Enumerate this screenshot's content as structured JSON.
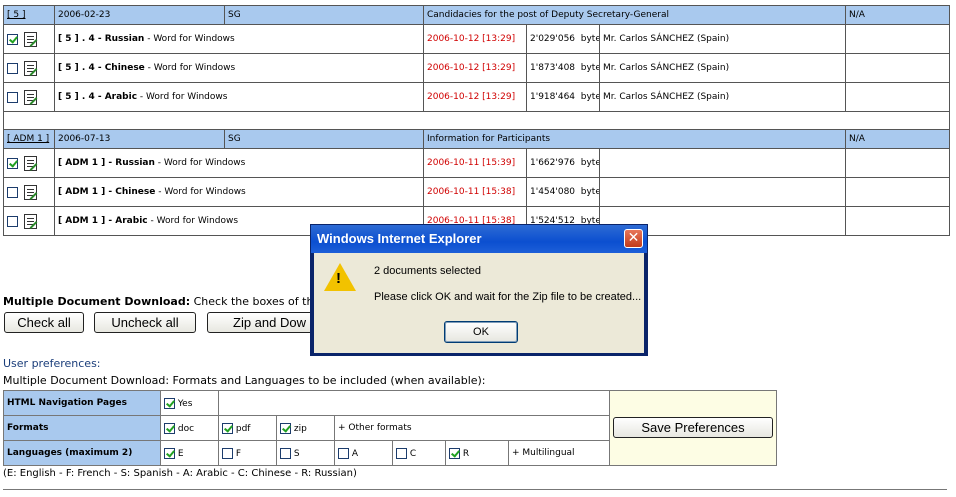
{
  "groups": [
    {
      "ref": "[ 5 ]",
      "date": "2006-02-23",
      "org": "SG",
      "title": "Candidacies for the post of Deputy Secretary-General",
      "status": "N/A",
      "rows": [
        {
          "checked": true,
          "name": "[ 5 ] . 4 - Russian",
          "format": "Word for Windows",
          "timestamp": "2006-10-12 [13:29]",
          "size": "2'029'056",
          "unit": "bytes",
          "author": "Mr. Carlos SÁNCHEZ (Spain)"
        },
        {
          "checked": false,
          "name": "[ 5 ] . 4 - Chinese",
          "format": "Word for Windows",
          "timestamp": "2006-10-12 [13:29]",
          "size": "1'873'408",
          "unit": "bytes",
          "author": "Mr. Carlos SÁNCHEZ (Spain)"
        },
        {
          "checked": false,
          "name": "[ 5 ] . 4 - Arabic",
          "format": "Word for Windows",
          "timestamp": "2006-10-12 [13:29]",
          "size": "1'918'464",
          "unit": "bytes",
          "author": "Mr. Carlos SÁNCHEZ (Spain)"
        }
      ]
    },
    {
      "ref": "[ ADM 1 ]",
      "date": "2006-07-13",
      "org": "SG",
      "title": "Information for Participants",
      "status": "N/A",
      "rows": [
        {
          "checked": true,
          "name": "[ ADM 1 ] - Russian",
          "format": "Word for Windows",
          "timestamp": "2006-10-11 [15:39]",
          "size": "1'662'976",
          "unit": "bytes",
          "author": ""
        },
        {
          "checked": false,
          "name": "[ ADM 1 ] - Chinese",
          "format": "Word for Windows",
          "timestamp": "2006-10-11 [15:38]",
          "size": "1'454'080",
          "unit": "bytes",
          "author": ""
        },
        {
          "checked": false,
          "name": "[ ADM 1 ] - Arabic",
          "format": "Word for Windows",
          "timestamp": "2006-10-11 [15:38]",
          "size": "1'524'512",
          "unit": "bytes",
          "author": ""
        }
      ]
    }
  ],
  "download": {
    "label_bold": "Multiple Document Download:",
    "label_rest": "Check the boxes of the",
    "check_all": "Check all",
    "uncheck_all": "Uncheck all",
    "zip": "Zip and Dow"
  },
  "prefs": {
    "heading": "User preferences:",
    "subheading": "Multiple Document Download: Formats and Languages to be included (when available):",
    "html_nav_label": "HTML Navigation Pages",
    "yes_label": "Yes",
    "formats_label": "Formats",
    "formats": [
      {
        "label": "doc",
        "checked": true
      },
      {
        "label": "pdf",
        "checked": true
      },
      {
        "label": "zip",
        "checked": true
      }
    ],
    "other_formats": "+ Other formats",
    "languages_label": "Languages (maximum 2)",
    "languages": [
      {
        "label": "E",
        "checked": true
      },
      {
        "label": "F",
        "checked": false
      },
      {
        "label": "S",
        "checked": false
      },
      {
        "label": "A",
        "checked": false
      },
      {
        "label": "C",
        "checked": false
      },
      {
        "label": "R",
        "checked": true
      }
    ],
    "multilingual": "+ Multilingual",
    "save_button": "Save Preferences",
    "legend": "(E: English - F: French - S: Spanish - A: Arabic - C: Chinese - R: Russian)"
  },
  "dialog": {
    "title": "Windows Internet Explorer",
    "close_glyph": "✕",
    "warn_glyph": "!",
    "message1": "2 documents selected",
    "message2": "Please click OK and wait for the Zip file to be created...",
    "ok": "OK"
  },
  "colors": {
    "header_blue": "#a9c9ee",
    "timestamp_red": "#d00000",
    "title_bar": "#0b4fd0",
    "prefs_yellow": "#fdfde4"
  }
}
